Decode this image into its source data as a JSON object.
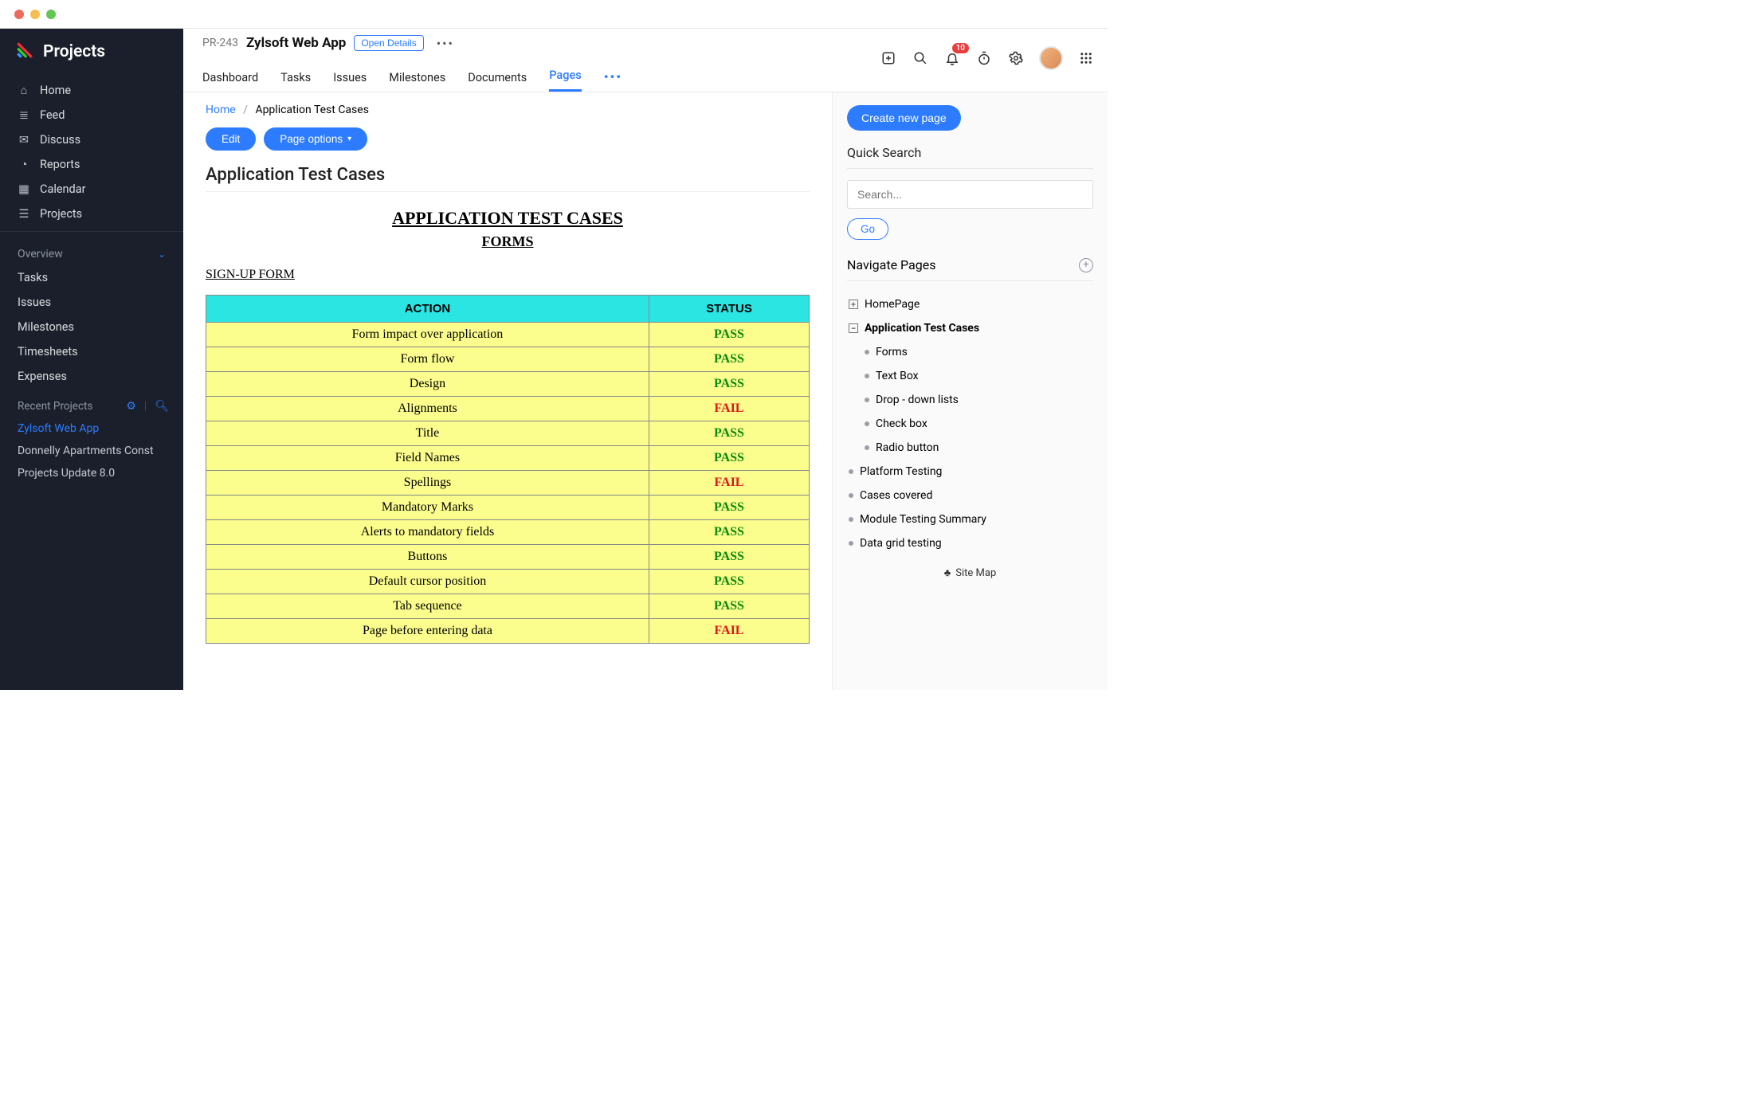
{
  "brand": {
    "text": "Projects"
  },
  "nav": {
    "items": [
      {
        "label": "Home"
      },
      {
        "label": "Feed"
      },
      {
        "label": "Discuss"
      },
      {
        "label": "Reports"
      },
      {
        "label": "Calendar"
      },
      {
        "label": "Projects"
      }
    ],
    "overview_label": "Overview",
    "overview_items": [
      {
        "label": "Tasks"
      },
      {
        "label": "Issues"
      },
      {
        "label": "Milestones"
      },
      {
        "label": "Timesheets"
      },
      {
        "label": "Expenses"
      }
    ],
    "recent_label": "Recent Projects",
    "recent_items": [
      {
        "label": "Zylsoft Web App",
        "active": true
      },
      {
        "label": "Donnelly Apartments Const"
      },
      {
        "label": "Projects Update 8.0"
      }
    ]
  },
  "header": {
    "project_code": "PR-243",
    "project_name": "Zylsoft Web App",
    "open_details_label": "Open Details",
    "notification_count": "10",
    "tabs": [
      {
        "label": "Dashboard"
      },
      {
        "label": "Tasks"
      },
      {
        "label": "Issues"
      },
      {
        "label": "Milestones"
      },
      {
        "label": "Documents"
      },
      {
        "label": "Pages",
        "active": true
      }
    ]
  },
  "breadcrumb": {
    "home": "Home",
    "current": "Application Test Cases"
  },
  "buttons": {
    "edit": "Edit",
    "page_options": "Page options"
  },
  "page": {
    "title": "Application Test Cases",
    "doc_h1": "APPLICATION TEST CASES",
    "doc_h2": "FORMS",
    "doc_h3": "SIGN-UP FORM",
    "table": {
      "headers": {
        "action": "ACTION",
        "status": "STATUS"
      },
      "rows": [
        {
          "action": "Form impact over application",
          "status": "PASS"
        },
        {
          "action": "Form flow",
          "status": "PASS"
        },
        {
          "action": "Design",
          "status": "PASS"
        },
        {
          "action": "Alignments",
          "status": "FAIL"
        },
        {
          "action": "Title",
          "status": "PASS"
        },
        {
          "action": "Field Names",
          "status": "PASS"
        },
        {
          "action": "Spellings",
          "status": "FAIL"
        },
        {
          "action": "Mandatory Marks",
          "status": "PASS"
        },
        {
          "action": "Alerts to mandatory fields",
          "status": "PASS"
        },
        {
          "action": "Buttons",
          "status": "PASS"
        },
        {
          "action": "Default cursor position",
          "status": "PASS"
        },
        {
          "action": "Tab sequence",
          "status": "PASS"
        },
        {
          "action": "Page before entering data",
          "status": "FAIL"
        }
      ]
    }
  },
  "right": {
    "create_label": "Create new page",
    "quick_search_label": "Quick Search",
    "search_placeholder": "Search...",
    "go_label": "Go",
    "navigate_label": "Navigate Pages",
    "site_map_label": "Site Map",
    "tree": {
      "homepage": "HomePage",
      "app_test_cases": "Application Test Cases",
      "children": [
        "Forms",
        "Text Box",
        "Drop - down lists",
        "Check box",
        "Radio button"
      ],
      "siblings": [
        "Platform Testing",
        "Cases covered",
        "Module Testing Summary",
        "Data grid testing"
      ]
    }
  }
}
